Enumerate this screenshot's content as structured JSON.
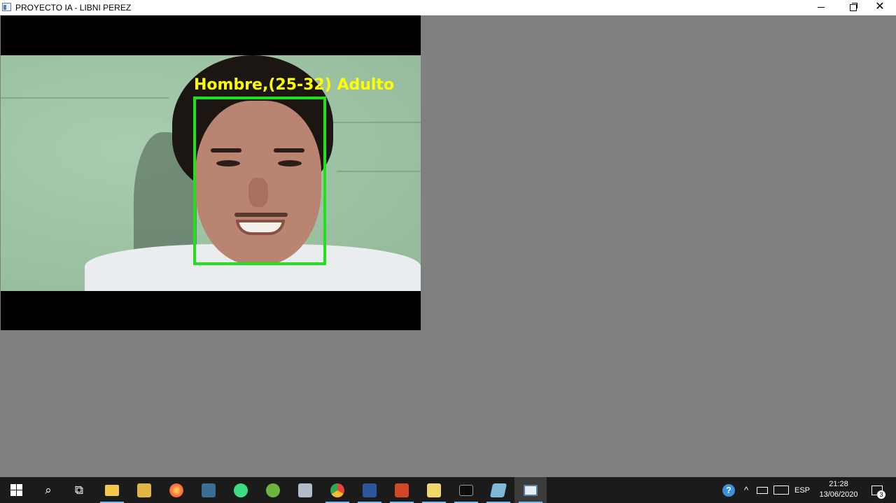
{
  "window": {
    "title": "PROYECTO IA - LIBNI PEREZ",
    "minimize_label": "",
    "maximize_label": "",
    "close_label": "✕"
  },
  "detection": {
    "label": "Hombre,(25-32) Adulto",
    "box_color": "#22e01c",
    "text_color": "#ffff00"
  },
  "taskbar": {
    "apps": [
      {
        "name": "start-button",
        "icon": "windows-logo-icon"
      },
      {
        "name": "search-button",
        "icon": "search-icon",
        "glyph": "⌕"
      },
      {
        "name": "task-view-button",
        "icon": "task-view-icon",
        "glyph": "⧉"
      },
      {
        "name": "file-explorer",
        "icon": "folder-icon",
        "color": "#f2c94c",
        "running": true
      },
      {
        "name": "app-tool",
        "icon": "tool-icon",
        "color": "#e0b545",
        "running": false
      },
      {
        "name": "firefox",
        "icon": "firefox-icon",
        "color": "#ff7139",
        "running": false
      },
      {
        "name": "mysql-workbench",
        "icon": "dolphin-icon",
        "color": "#3a6e94",
        "running": false
      },
      {
        "name": "android-studio",
        "icon": "android-icon",
        "color": "#3ddc84",
        "running": false
      },
      {
        "name": "spring-tool",
        "icon": "leaf-icon",
        "color": "#6db33f",
        "running": false
      },
      {
        "name": "app-printer",
        "icon": "printer-icon",
        "color": "#b0bcc8",
        "running": false
      },
      {
        "name": "chrome",
        "icon": "chrome-icon",
        "color": "#e8453c",
        "running": true
      },
      {
        "name": "word",
        "icon": "word-icon",
        "color": "#2b579a",
        "running": true
      },
      {
        "name": "powerpoint",
        "icon": "powerpoint-icon",
        "color": "#d24726",
        "running": true
      },
      {
        "name": "python-file",
        "icon": "python-file-icon",
        "color": "#f2d76b",
        "running": true
      },
      {
        "name": "terminal",
        "icon": "terminal-icon",
        "color": "#0c0c0c",
        "running": true
      },
      {
        "name": "app-notes",
        "icon": "notes-icon",
        "color": "#7fb7d6",
        "running": true
      },
      {
        "name": "proyecto-ia-window",
        "icon": "window-icon",
        "color": "#e8eef5",
        "running": true,
        "active": true
      }
    ],
    "tray": {
      "language": "ESP",
      "time": "21:28",
      "date": "13/06/2020",
      "notification_count": "3"
    }
  }
}
